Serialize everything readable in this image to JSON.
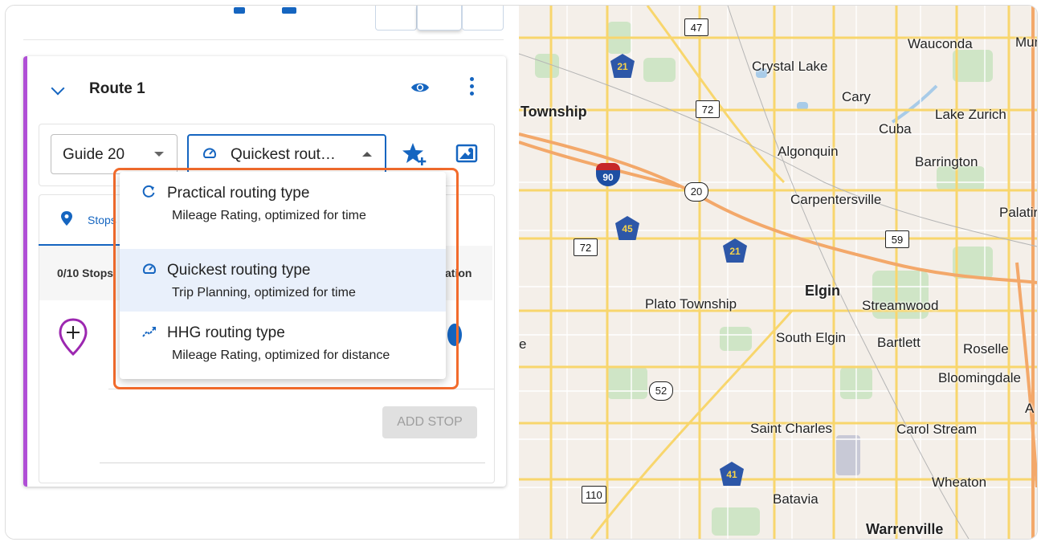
{
  "route": {
    "title": "Route 1",
    "guide_select": "Guide 20",
    "routing_select": "Quickest rout…",
    "stops_tab": "Stops",
    "stops_count": "0/10 Stops",
    "stops_partial": "ation",
    "add_stop": "ADD STOP"
  },
  "routing_menu": [
    {
      "icon": "practical-route-icon",
      "title": "Practical routing type",
      "subtitle": "Mileage Rating, optimized for time"
    },
    {
      "icon": "quickest-gauge-icon",
      "title": "Quickest routing type",
      "subtitle": "Trip Planning, optimized for time",
      "selected": true
    },
    {
      "icon": "hhg-trend-icon",
      "title": "HHG routing type",
      "subtitle": "Mileage Rating, optimized for distance"
    }
  ],
  "colors": {
    "accent": "#1565c0",
    "route_stripe": "#b04fd6",
    "highlight": "#f26b2c",
    "add_pin": "#9c27b0"
  },
  "map": {
    "places": [
      "Wauconda",
      "Mun",
      "Crystal Lake",
      "Cary",
      "Lake Zurich",
      "Township",
      "Cuba",
      "Algonquin",
      "Barrington",
      "Carpentersville",
      "Palatir",
      "Elgin",
      "Plato Township",
      "Streamwood",
      "South Elgin",
      "Bartlett",
      "Roselle",
      "Bloomingdale",
      "A",
      "Saint Charles",
      "Carol Stream",
      "Wheaton",
      "Batavia",
      "Warrenville",
      "e"
    ],
    "route_shields": [
      "47",
      "21",
      "72",
      "90",
      "20",
      "45",
      "72",
      "21",
      "59",
      "52",
      "41",
      "110"
    ]
  }
}
